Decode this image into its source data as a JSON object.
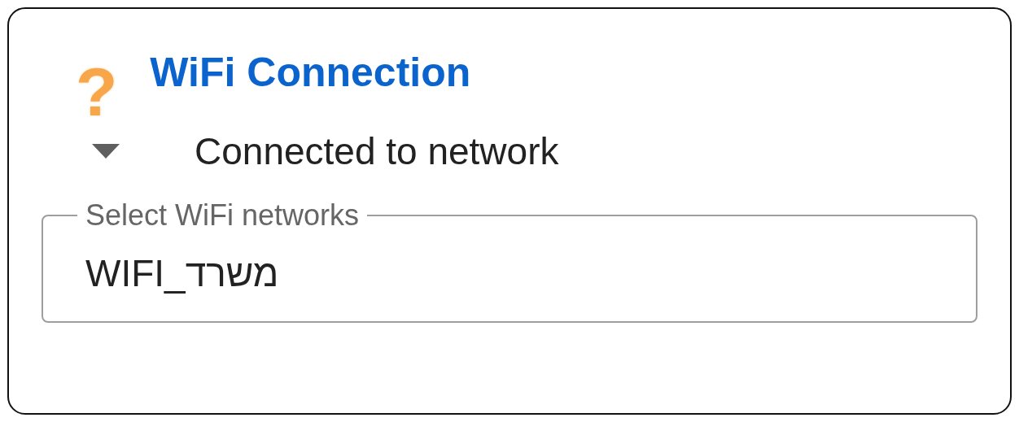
{
  "card": {
    "icon": "?",
    "title": "WiFi Connection"
  },
  "status": {
    "text": "Connected to network"
  },
  "network_field": {
    "label": "Select WiFi networks",
    "value": "WIFI_משרד"
  }
}
